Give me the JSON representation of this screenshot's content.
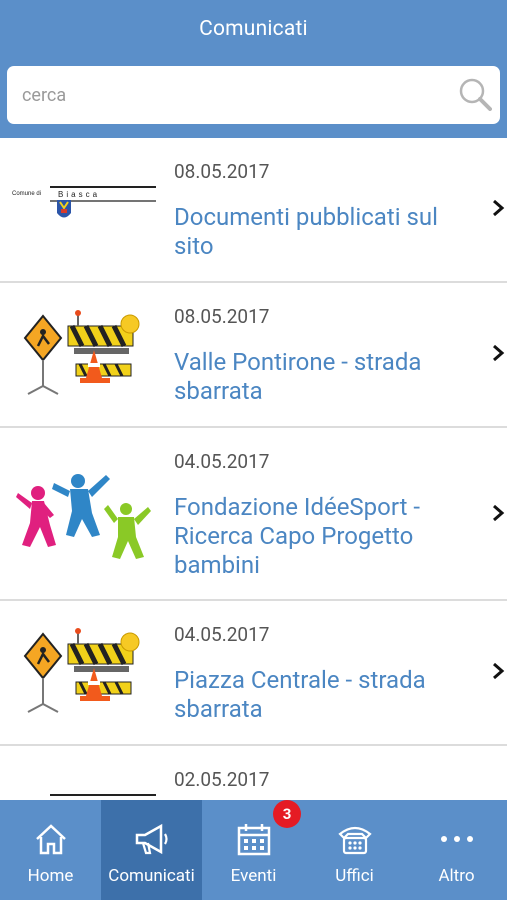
{
  "header": {
    "title": "Comunicati"
  },
  "search": {
    "placeholder": "cerca"
  },
  "items": [
    {
      "date": "08.05.2017",
      "title": "Documenti pubblicati sul sito",
      "thumb": "comune-di-biasca-logo",
      "thumb_text": "Comune di  Biasca"
    },
    {
      "date": "08.05.2017",
      "title": "Valle Pontirone - strada sbarrata",
      "thumb": "roadworks-barrier"
    },
    {
      "date": "04.05.2017",
      "title": "Fondazione IdéeSport - Ricerca Capo Progetto bambini",
      "thumb": "jumping-people"
    },
    {
      "date": "04.05.2017",
      "title": "Piazza Centrale - strada sbarrata",
      "thumb": "roadworks-barrier"
    },
    {
      "date": "02.05.2017",
      "title": "",
      "thumb": "comune-di-biasca-logo"
    }
  ],
  "tabs": [
    {
      "label": "Home",
      "icon": "home-icon",
      "active": false
    },
    {
      "label": "Comunicati",
      "icon": "megaphone-icon",
      "active": true
    },
    {
      "label": "Eventi",
      "icon": "calendar-icon",
      "active": false,
      "badge": "3"
    },
    {
      "label": "Uffici",
      "icon": "phone-icon",
      "active": false
    },
    {
      "label": "Altro",
      "icon": "more-icon",
      "active": false
    }
  ],
  "colors": {
    "header_bg": "#5b8fc9",
    "tab_active_bg": "#3d70aa",
    "title_text": "#4b86c2",
    "badge_bg": "#e51b24"
  }
}
